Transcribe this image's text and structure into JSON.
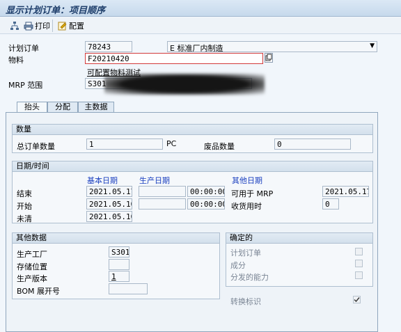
{
  "window": {
    "title": "显示计划订单：项目顺序"
  },
  "toolbar": {
    "print_label": "打印",
    "config_label": "配置"
  },
  "header": {
    "planned_order_label": "计划订单",
    "planned_order_value": "78243",
    "procurement_type_value": "E 标准厂内制造",
    "material_label": "物料",
    "material_value": "F20210420",
    "material_desc": "可配置物料测试",
    "mrp_area_label": "MRP 范围",
    "mrp_area_value": "S301"
  },
  "tabs": [
    {
      "label": "抬头"
    },
    {
      "label": "分配"
    },
    {
      "label": "主数据"
    }
  ],
  "quantity": {
    "title": "数量",
    "total_label": "总订单数量",
    "total_value": "1",
    "unit": "PC",
    "scrap_label": "废品数量",
    "scrap_value": "0"
  },
  "dates": {
    "title": "日期/时间",
    "basic_dates_label": "基本日期",
    "production_dates_label": "生产日期",
    "other_dates_label": "其他日期",
    "finish_label": "结束",
    "finish_basic": "2021.05.17",
    "finish_prod_time": "00:00:00",
    "start_label": "开始",
    "start_basic": "2021.05.10",
    "start_prod_time": "00:00:00",
    "open_label": "未清",
    "open_basic": "2021.05.10",
    "available_mrp_label": "可用于 MRP",
    "available_mrp_value": "2021.05.17",
    "gr_time_label": "收货用时",
    "gr_time_value": "0"
  },
  "other_data": {
    "title": "其他数据",
    "plant_label": "生产工厂",
    "plant_value": "S301",
    "storage_label": "存储位置",
    "storage_value": "",
    "version_label": "生产版本",
    "version_value": "1",
    "bom_label": "BOM 展开号",
    "bom_value": ""
  },
  "firmed": {
    "title": "确定的",
    "planned_order_label": "计划订单",
    "components_label": "成分",
    "capacity_label": "分发的能力",
    "conversion_label": "转换标识"
  }
}
